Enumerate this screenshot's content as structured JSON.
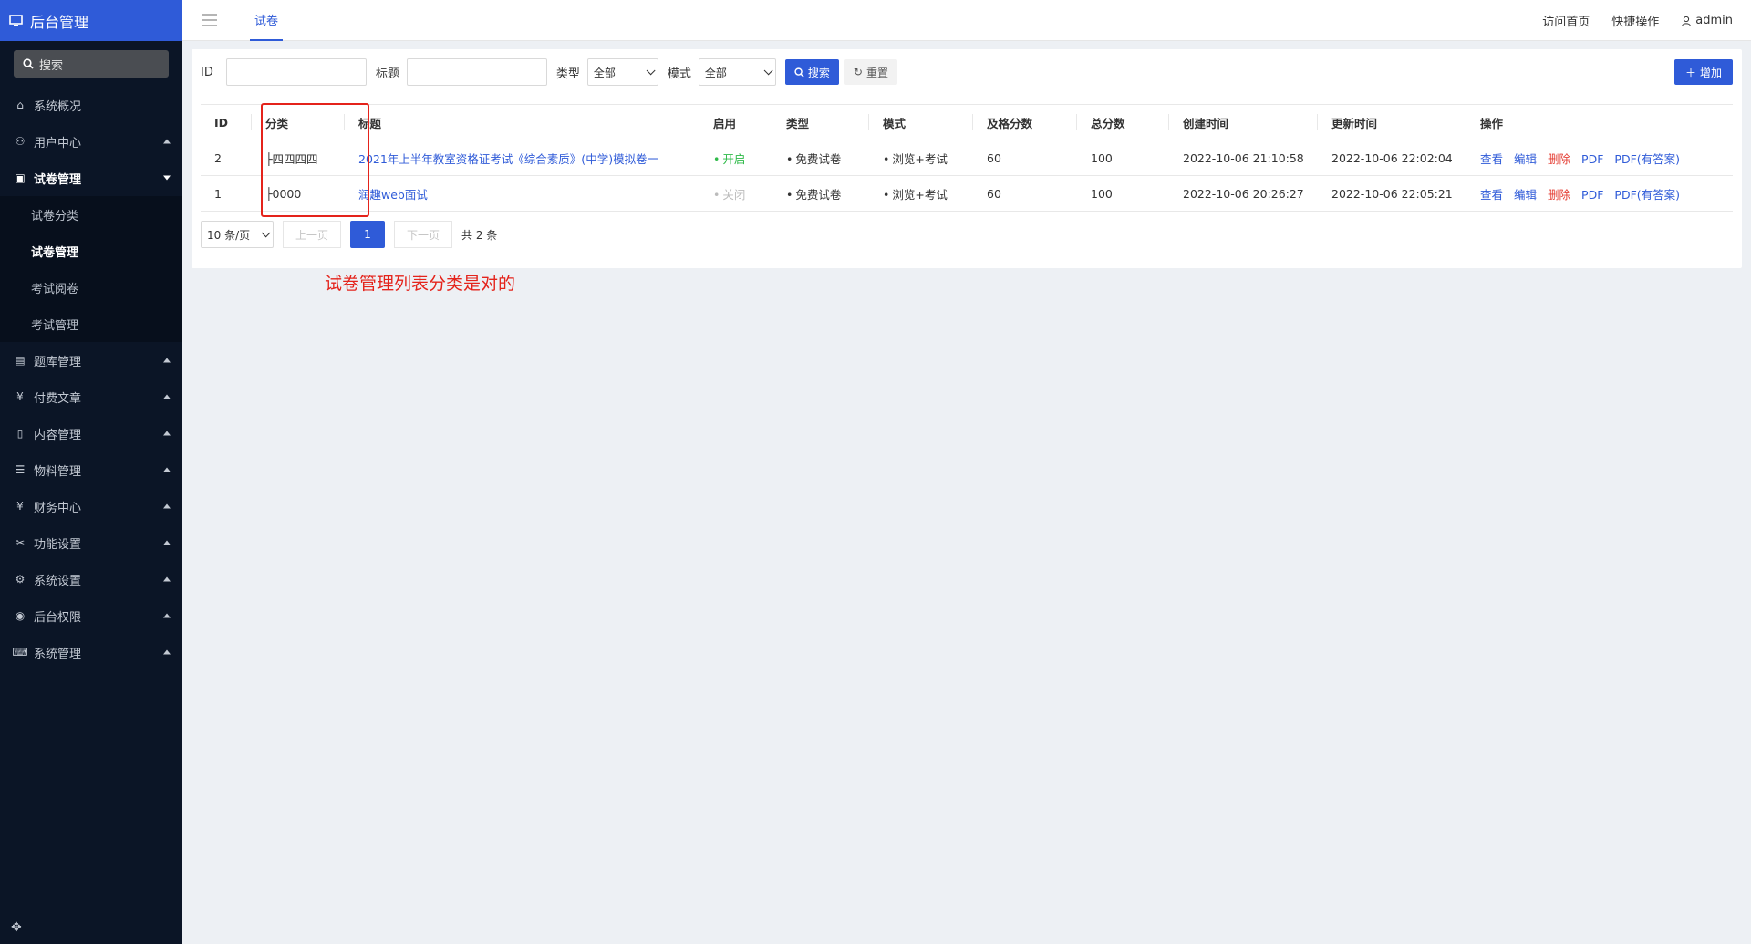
{
  "sidebar": {
    "brand": "后台管理",
    "search_label": "搜索",
    "items": [
      {
        "label": "系统概况",
        "icon": "home-icon"
      },
      {
        "label": "用户中心",
        "icon": "users-icon"
      },
      {
        "label": "试卷管理",
        "icon": "exam-icon",
        "children": [
          "试卷分类",
          "试卷管理",
          "考试阅卷",
          "考试管理"
        ]
      },
      {
        "label": "题库管理",
        "icon": "doc-icon"
      },
      {
        "label": "付费文章",
        "icon": "yen-icon"
      },
      {
        "label": "内容管理",
        "icon": "file-icon"
      },
      {
        "label": "物料管理",
        "icon": "list-icon"
      },
      {
        "label": "财务中心",
        "icon": "yen-icon"
      },
      {
        "label": "功能设置",
        "icon": "tools-icon"
      },
      {
        "label": "系统设置",
        "icon": "gear-icon"
      },
      {
        "label": "后台权限",
        "icon": "user-circle-icon"
      },
      {
        "label": "系统管理",
        "icon": "keyboard-icon"
      }
    ]
  },
  "topbar": {
    "tab": "试卷",
    "links": [
      "访问首页",
      "快捷操作"
    ],
    "user": "admin"
  },
  "filters": {
    "id_label": "ID",
    "title_label": "标题",
    "type_label": "类型",
    "type_value": "全部",
    "mode_label": "模式",
    "mode_value": "全部",
    "search_button": "搜索",
    "reset_button": "重置",
    "add_button": "增加"
  },
  "table": {
    "columns": [
      "ID",
      "分类",
      "标题",
      "启用",
      "类型",
      "模式",
      "及格分数",
      "总分数",
      "创建时间",
      "更新时间",
      "操作"
    ],
    "rows": [
      {
        "id": "2",
        "category": "├四四四四",
        "title": "2021年上半年教室资格证考试《综合素质》(中学)模拟卷一",
        "status": "开启",
        "type": "免费试卷",
        "mode": "浏览+考试",
        "pass": "60",
        "total": "100",
        "created": "2022-10-06 21:10:58",
        "updated": "2022-10-06 22:02:04"
      },
      {
        "id": "1",
        "category": "├0000",
        "title": "润趣web面试",
        "status": "关闭",
        "type": "免费试卷",
        "mode": "浏览+考试",
        "pass": "60",
        "total": "100",
        "created": "2022-10-06 20:26:27",
        "updated": "2022-10-06 22:05:21"
      }
    ],
    "actions": [
      "查看",
      "编辑",
      "删除",
      "PDF",
      "PDF(有答案)"
    ]
  },
  "pager": {
    "page_size": "10 条/页",
    "prev": "上一页",
    "current": "1",
    "next": "下一页",
    "total": "共 2 条"
  },
  "annotation": "试卷管理列表分类是对的",
  "colors": {
    "primary": "#2f5bd8",
    "sidebar_bg": "#0b1526",
    "danger": "#e43d33",
    "success": "#2fba49",
    "annotation": "#e4231b"
  }
}
